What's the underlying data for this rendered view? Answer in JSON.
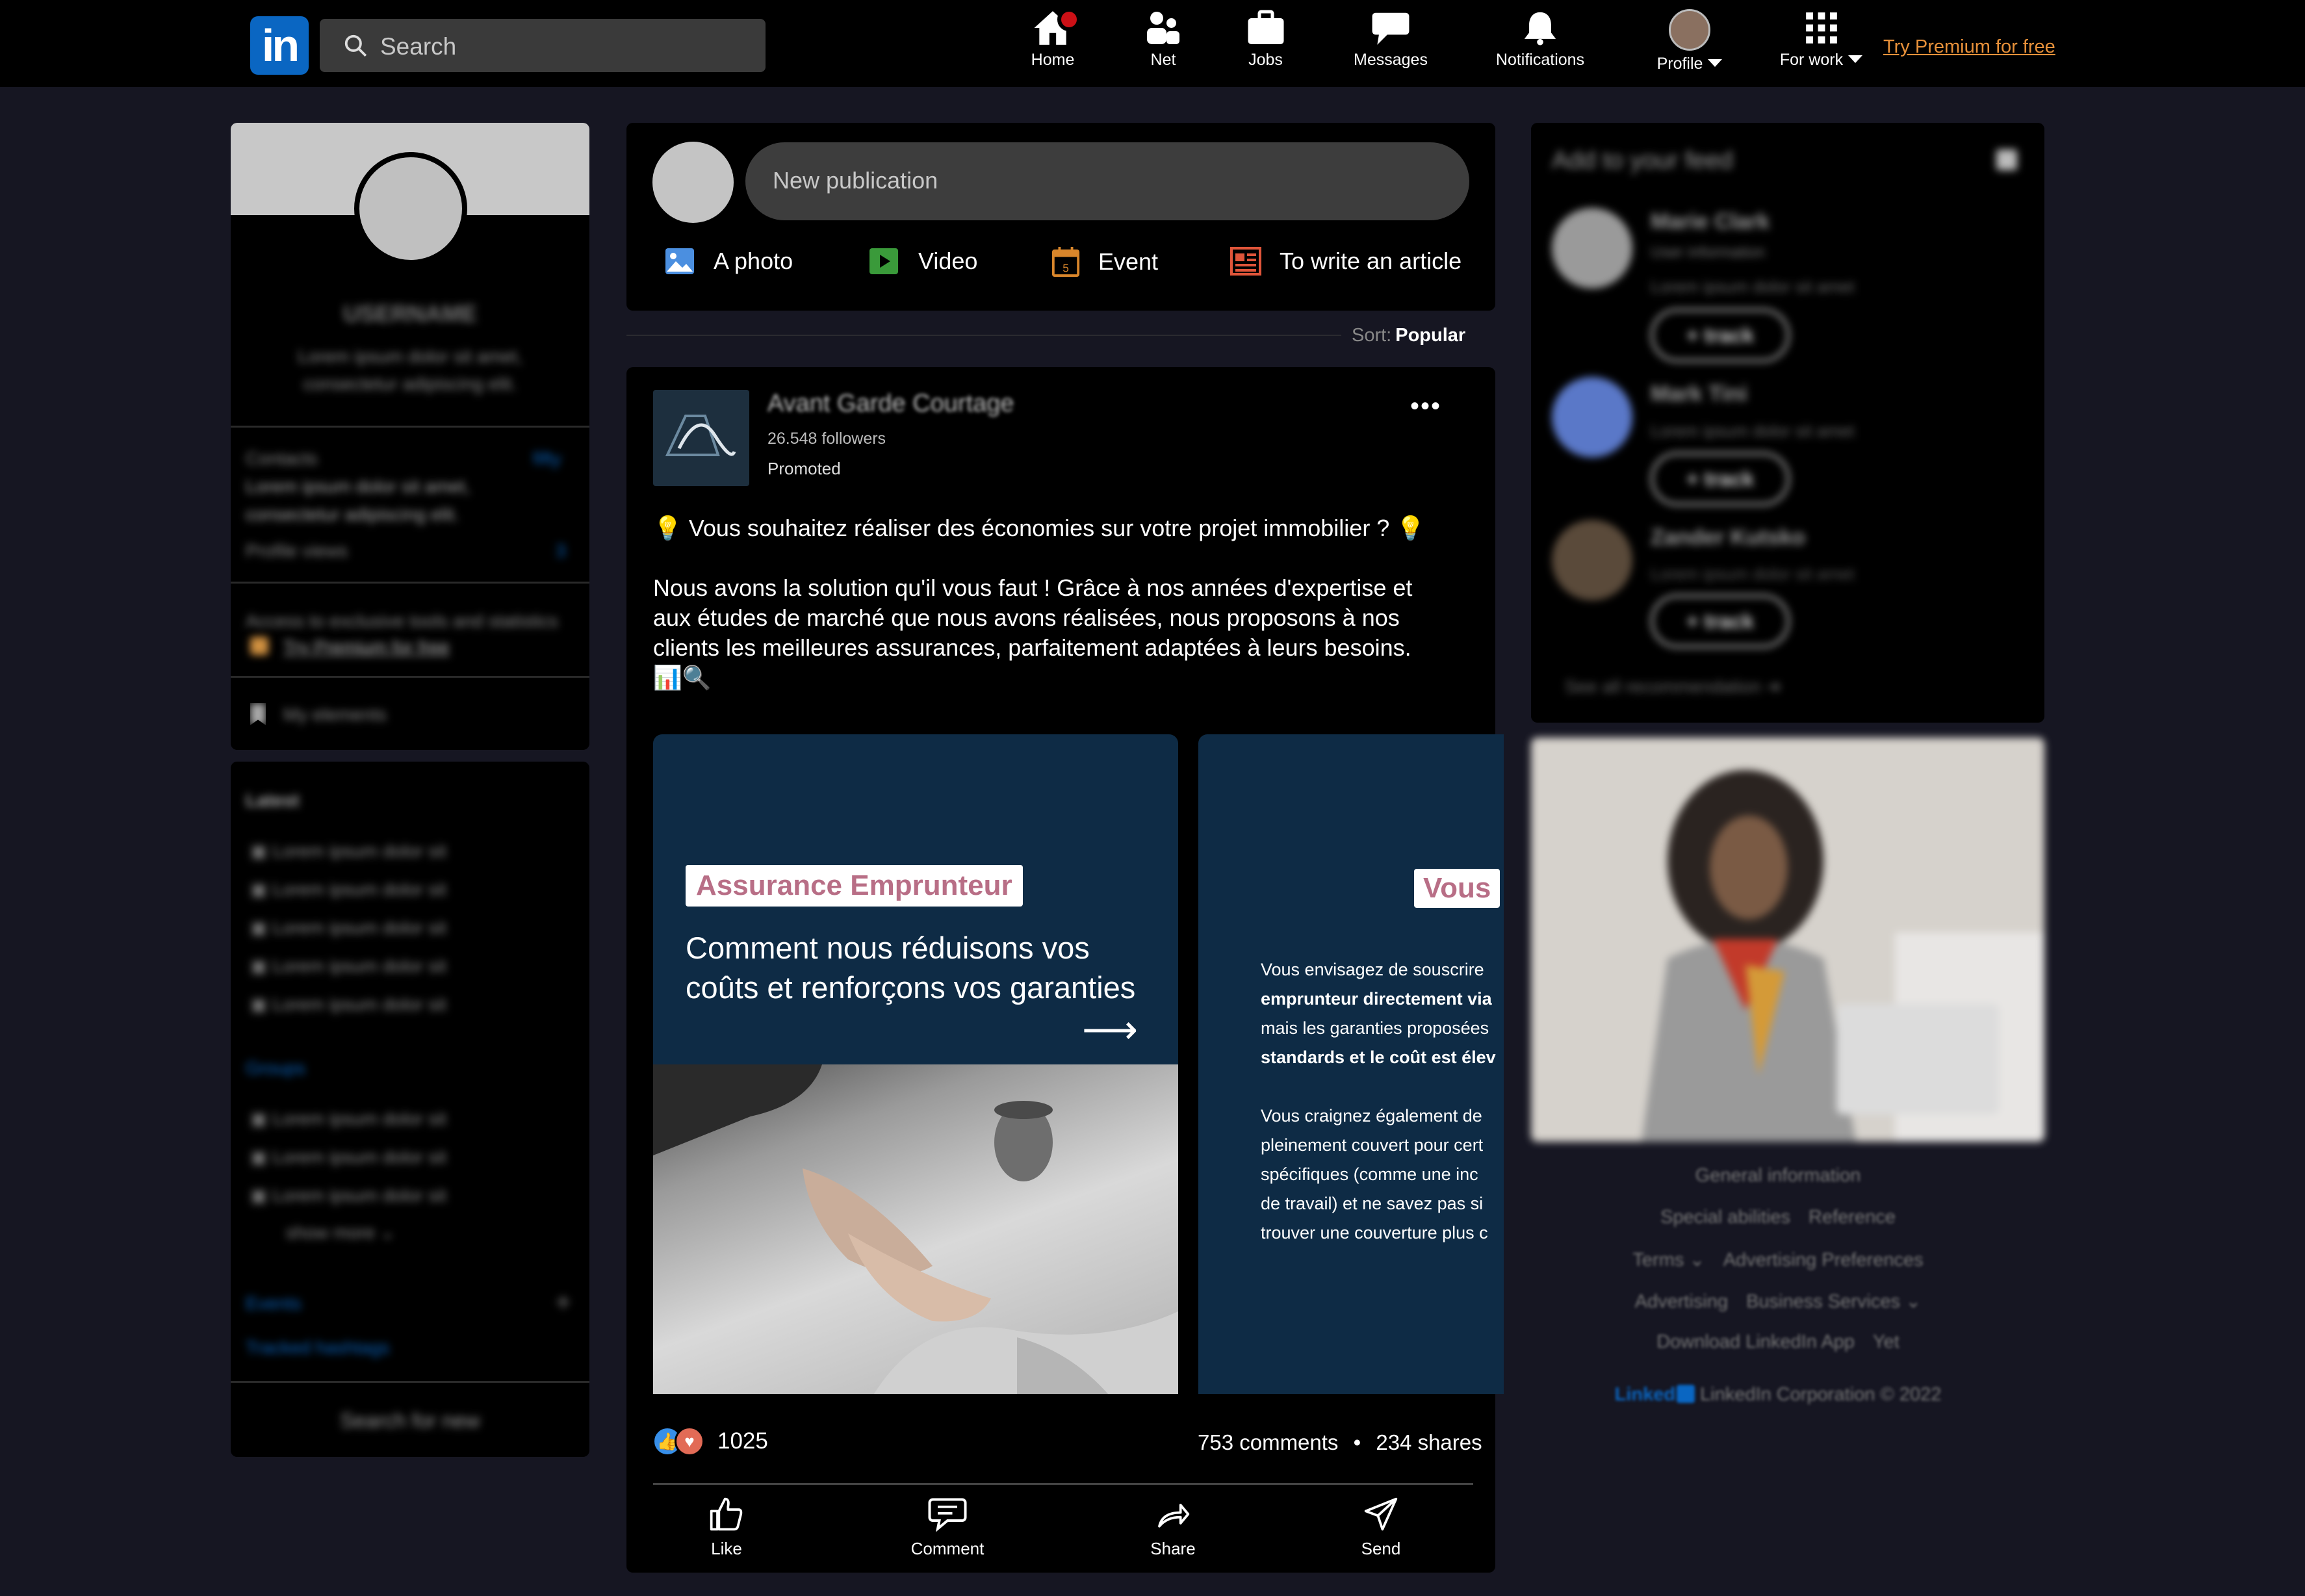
{
  "header": {
    "logo_text": "in",
    "search_placeholder": "Search",
    "nav": [
      {
        "label": "Home",
        "icon": "home-icon"
      },
      {
        "label": "Net",
        "icon": "network-icon"
      },
      {
        "label": "Jobs",
        "icon": "briefcase-icon"
      },
      {
        "label": "Messages",
        "icon": "message-icon"
      },
      {
        "label": "Notifications",
        "icon": "bell-icon"
      },
      {
        "label": "Profile",
        "icon": "avatar"
      },
      {
        "label": "For work",
        "icon": "grid-icon"
      }
    ],
    "premium_link": "Try Premium for free",
    "accent_color": "#0a66c2",
    "premium_color": "#e8913a"
  },
  "left": {
    "username": "USERNAME",
    "bio": "Lorem ipsum dolor sit amet, consectetur adipiscing elit.",
    "contacts_label": "Contacts",
    "contacts_value": "fifty",
    "contacts_text": "Lorem ipsum dolor sit amet, consectetur adipiscing elit.",
    "views_label": "Profile views",
    "views_value": "3",
    "access_text": "Access to exclusive tools and statistics",
    "premium_text": "Try Premium for free",
    "my_elements": "My elements",
    "latest_title": "Latest",
    "latest_items": [
      "Lorem ipsum dolor sit",
      "Lorem ipsum dolor sit",
      "Lorem ipsum dolor sit",
      "Lorem ipsum dolor sit",
      "Lorem ipsum dolor sit"
    ],
    "groups_title": "Groups",
    "groups_items": [
      "Lorem ipsum dolor sit",
      "Lorem ipsum dolor sit",
      "Lorem ipsum dolor sit"
    ],
    "show_more": "show more",
    "events": "Events",
    "hashtags": "Tracked hashtags",
    "search_new": "Search for new"
  },
  "composer": {
    "placeholder": "New publication",
    "actions": [
      {
        "label": "A photo",
        "icon": "photo-icon"
      },
      {
        "label": "Video",
        "icon": "video-icon"
      },
      {
        "label": "Event",
        "icon": "calendar-icon"
      },
      {
        "label": "To write an article",
        "icon": "article-icon"
      }
    ]
  },
  "sort": {
    "label": "Sort:",
    "value": "Popular"
  },
  "post": {
    "company": "Avant Garde Courtage",
    "followers": "26.548 followers",
    "promoted": "Promoted",
    "text": "💡 Vous souhaitez réaliser des économies sur votre projet immobilier ? 💡\n\nNous avons la solution qu'il vous faut ! Grâce à nos années d'expertise et aux études de marché que nous avons réalisées, nous proposons à nos clients les meilleures assurances, parfaitement adaptées à leurs besoins.\n📊🔍",
    "slide1": {
      "tag": "Assurance Emprunteur",
      "heading": "Comment nous réduisons vos coûts et renforçons vos garanties",
      "arrow": "⟶"
    },
    "slide2": {
      "tag": "Vous",
      "lines": [
        {
          "text": "Vous envisagez de souscrire",
          "bold": false
        },
        {
          "text": "emprunteur directement via",
          "bold": true
        },
        {
          "text": "mais les garanties proposées",
          "bold": false
        },
        {
          "text": "standards et le coût est élev",
          "bold": true
        },
        {
          "text": "",
          "bold": false
        },
        {
          "text": "Vous craignez également de",
          "bold": false
        },
        {
          "text": "pleinement couvert pour cert",
          "bold": false
        },
        {
          "text": "spécifiques (comme une inc",
          "bold": false
        },
        {
          "text": "de travail) et ne savez pas si",
          "bold": false
        },
        {
          "text": "trouver une couverture plus c",
          "bold": false
        }
      ]
    },
    "reactions_count": "1025",
    "comments": "753 comments",
    "separator": "•",
    "shares": "234 shares",
    "actions": [
      {
        "label": "Like",
        "icon": "like-icon"
      },
      {
        "label": "Comment",
        "icon": "comment-icon"
      },
      {
        "label": "Share",
        "icon": "share-icon"
      },
      {
        "label": "Send",
        "icon": "send-icon"
      }
    ]
  },
  "right": {
    "feed_title": "Add to your feed",
    "suggestions": [
      {
        "name": "Marie Clark",
        "sub": "User information",
        "desc": "Lorem ipsum dolor sit amet",
        "button": "+ track"
      },
      {
        "name": "Mark Tini",
        "sub": "",
        "desc": "Lorem ipsum dolor sit amet",
        "button": "+ track"
      },
      {
        "name": "Zander Kutsko",
        "sub": "",
        "desc": "Lorem ipsum dolor sit amet",
        "button": "+ track"
      }
    ],
    "see_all": "See all recommendation",
    "footer": [
      [
        "General information"
      ],
      [
        "Special abilities",
        "Reference"
      ],
      [
        "Terms",
        "Advertising Preferences"
      ],
      [
        "Advertising",
        "Business Services"
      ],
      [
        "Download LinkedIn App",
        "Yet"
      ]
    ],
    "copyright": "LinkedIn Corporation © 2022",
    "brand": "Linked"
  }
}
